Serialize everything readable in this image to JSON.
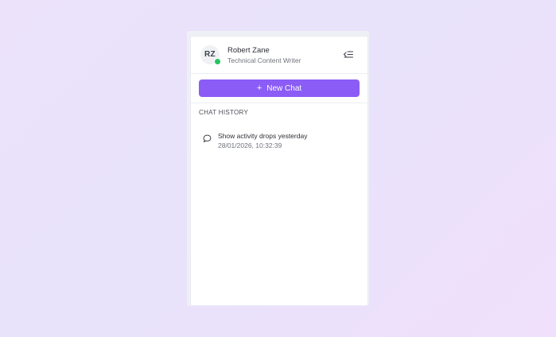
{
  "profile": {
    "initials": "RZ",
    "name": "Robert Zane",
    "role": "Technical Content Writer",
    "status_color": "#22c55e",
    "status_icon": "online-status-dot"
  },
  "sidebar": {
    "collapse_icon": "collapse-sidebar-icon",
    "new_chat": {
      "label": "New Chat",
      "icon": "plus-icon"
    },
    "accent_color": "#8b5cf6"
  },
  "history": {
    "title": "CHAT HISTORY",
    "items": [
      {
        "title": "Show activity drops yesterday",
        "timestamp": "28/01/2026, 10:32:39",
        "icon": "chat-bubble-icon"
      }
    ]
  }
}
